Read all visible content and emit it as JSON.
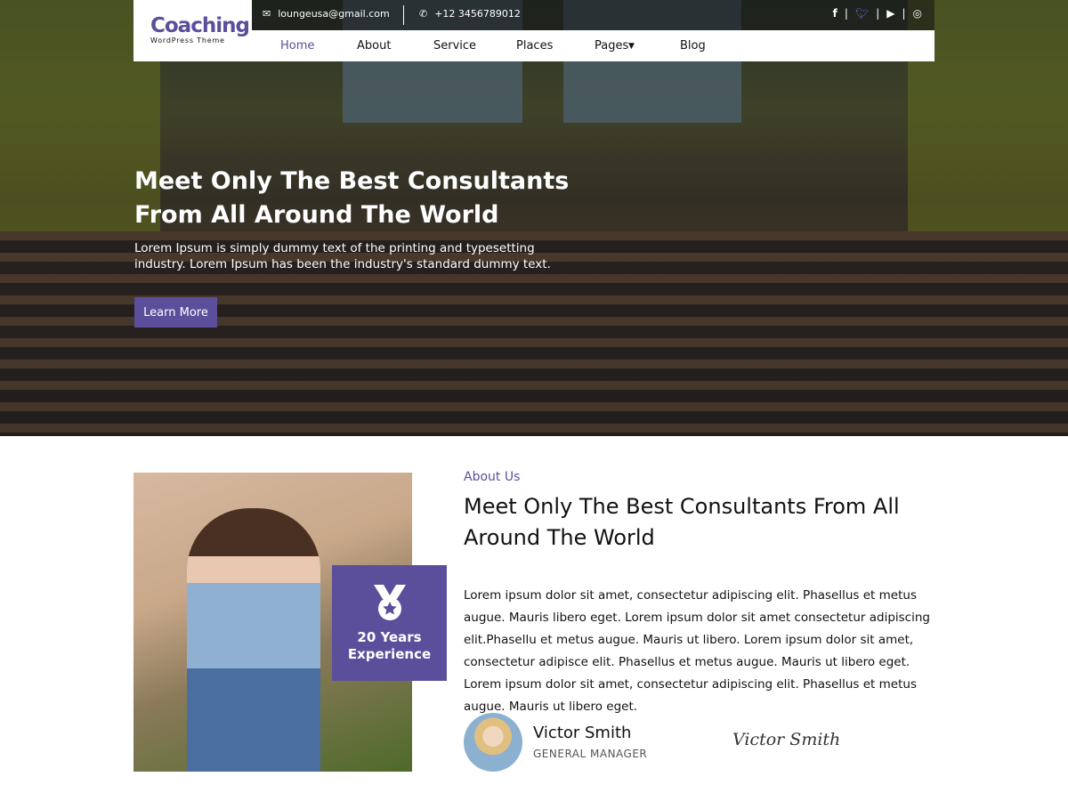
{
  "brand": {
    "name": "Coaching",
    "tagline": "WordPress Theme",
    "accent": "#5b4f9c"
  },
  "topbar": {
    "email": "loungeusa@gmail.com",
    "phone": "+12 3456789012",
    "social": [
      "facebook-icon",
      "twitter-icon",
      "youtube-icon",
      "instagram-icon"
    ]
  },
  "nav": [
    "Home",
    "About",
    "Service",
    "Places",
    "Pages",
    "Blog"
  ],
  "hero": {
    "title": "Meet Only The Best Consultants From All Around The World",
    "text": "Lorem Ipsum is simply dummy text of the printing and typesetting industry. Lorem Ipsum has been the industry's standard dummy text.",
    "button": "Learn More"
  },
  "experience": {
    "line1": "20 Years",
    "line2": "Experience"
  },
  "about": {
    "label": "About Us",
    "title": "Meet Only The Best Consultants From All Around The World",
    "body": "Lorem ipsum dolor sit amet, consectetur adipiscing elit. Phasellus et metus augue. Mauris libero eget. Lorem ipsum dolor sit amet consectetur adipiscing elit.Phasellu et metus augue. Mauris ut libero. Lorem ipsum dolor sit amet, consectetur adipisce elit. Phasellus et metus augue. Mauris ut libero eget. Lorem ipsum dolor sit amet, consectetur adipiscing elit. Phasellus et metus augue. Mauris ut libero eget."
  },
  "person": {
    "name": "Victor Smith",
    "role": "GENERAL MANAGER",
    "signature": "Victor Smith"
  }
}
